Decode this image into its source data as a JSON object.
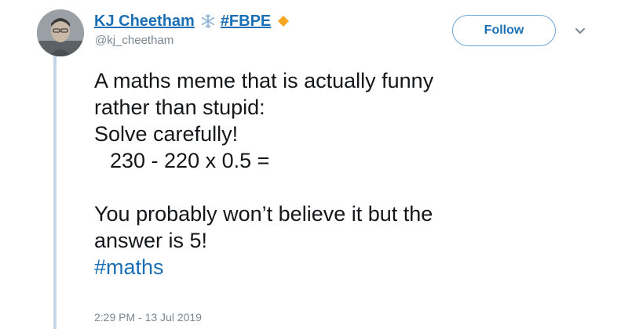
{
  "author": {
    "display_name": "KJ Cheetham",
    "tag": "#FBPE",
    "handle": "@kj_cheetham"
  },
  "actions": {
    "follow_label": "Follow"
  },
  "tweet": {
    "lines": [
      "A maths meme that is actually funny",
      "rather than stupid:",
      "Solve carefully!",
      "230 - 220 x 0.5 =",
      "You probably won’t believe it but the",
      "answer is 5!"
    ],
    "hashtag": "#maths",
    "timestamp": "2:29 PM - 13 Jul 2019"
  },
  "icons": {
    "snowflake": "snowflake-icon",
    "diamond": "orange-diamond-icon",
    "chevron": "chevron-down-icon"
  },
  "colors": {
    "link_blue": "#1b6fb5",
    "thread_line": "#c4d7e8",
    "diamond_orange": "#f5a623",
    "snowflake_blue": "#8fb4da"
  }
}
